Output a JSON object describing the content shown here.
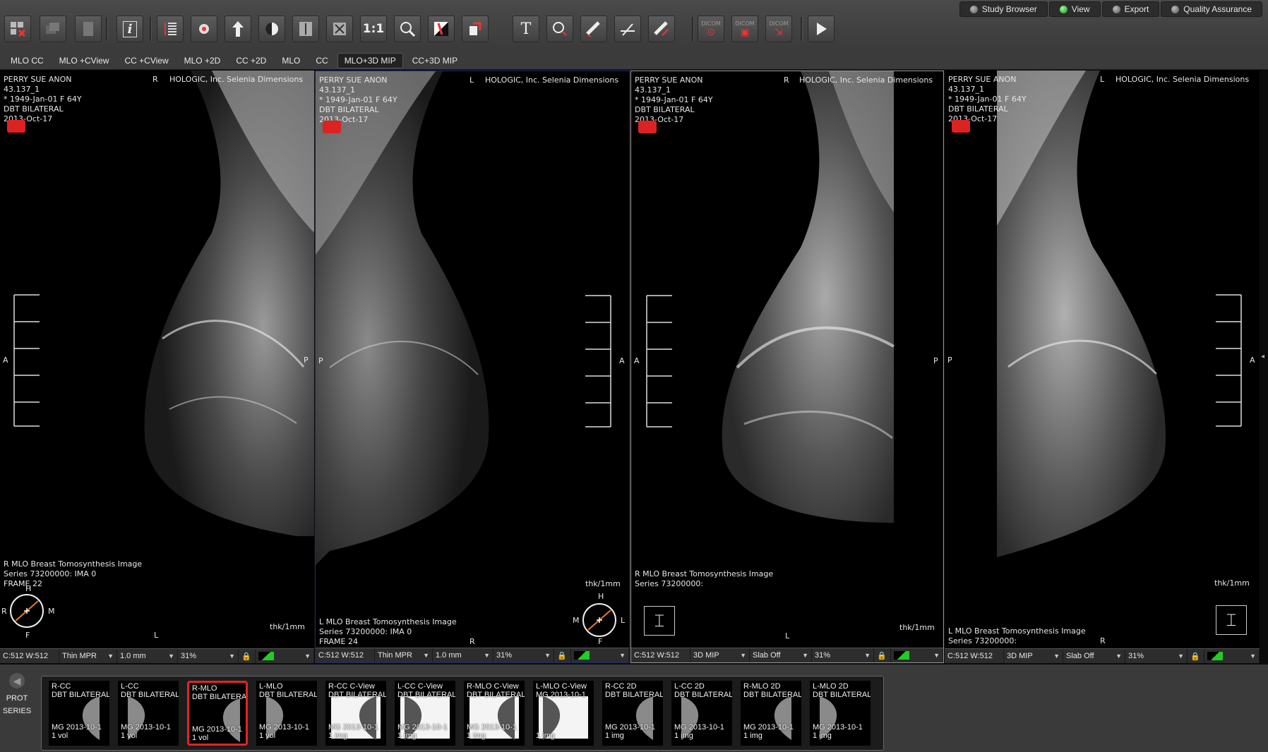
{
  "toolbar": {
    "buttons": [
      {
        "name": "close-all-icon"
      },
      {
        "name": "stack-icon"
      },
      {
        "name": "document-icon"
      },
      {
        "name": "info-icon",
        "label": "i"
      },
      {
        "name": "scroll-slices-icon"
      },
      {
        "name": "pan-hand-icon"
      },
      {
        "name": "move-arrow-icon"
      },
      {
        "name": "window-level-icon"
      },
      {
        "name": "fit-height-icon"
      },
      {
        "name": "fit-screen-icon"
      },
      {
        "name": "actual-size-icon",
        "label": "1:1"
      },
      {
        "name": "magnify-icon"
      },
      {
        "name": "invert-icon"
      },
      {
        "name": "rotate-icon"
      },
      {
        "name": "text-annotation-icon"
      },
      {
        "name": "ellipse-roi-icon"
      },
      {
        "name": "ruler-icon"
      },
      {
        "name": "angle-icon"
      },
      {
        "name": "measure-tools-icon"
      },
      {
        "name": "dicom-link-icon",
        "label": "DICOM"
      },
      {
        "name": "dicom-snapshot-icon",
        "label": "DICOM"
      },
      {
        "name": "dicom-export-icon",
        "label": "DICOM"
      },
      {
        "name": "play-cine-icon"
      }
    ]
  },
  "topnav": [
    {
      "label": "Study Browser",
      "on": false
    },
    {
      "label": "View",
      "on": true
    },
    {
      "label": "Export",
      "on": false
    },
    {
      "label": "Quality Assurance",
      "on": false
    }
  ],
  "hanging_protocols": [
    "MLO CC",
    "MLO +CView",
    "CC +CView",
    "MLO +2D",
    "CC +2D",
    "MLO",
    "CC",
    "MLO+3D MIP",
    "CC+3D MIP"
  ],
  "hp_active": "MLO+3D MIP",
  "viewports": [
    {
      "patient": "PERRY SUE ANON",
      "id": "43.137_1",
      "dob": "* 1949-Jan-01 F 64Y",
      "study": "DBT BILATERAL",
      "date": "2013-Oct-17",
      "laterality": "R",
      "vendor": "HOLOGIC, Inc. Selenia Dimensions",
      "left_marker": "A",
      "right_marker": "P",
      "bottom_marker": "L",
      "desc": "R MLO Breast Tomosynthesis Image",
      "series": "Series 73200000: IMA 0",
      "frame": "FRAME 22",
      "thk": "thk/1mm",
      "compass": {
        "top": "H",
        "bottom": "F",
        "left": "R",
        "right": "M"
      },
      "status": {
        "wl": "C:512 W:512",
        "mode": "Thin MPR",
        "slab": "1.0 mm",
        "zoom": "31%"
      }
    },
    {
      "patient": "PERRY SUE ANON",
      "id": "43.137_1",
      "dob": "* 1949-Jan-01 F 64Y",
      "study": "DBT BILATERAL",
      "date": "2013-Oct-17",
      "laterality": "L",
      "vendor": "HOLOGIC, Inc. Selenia Dimensions",
      "left_marker": "P",
      "right_marker": "A",
      "bottom_marker": "R",
      "desc": "L MLO Breast Tomosynthesis Image",
      "series": "Series 73200000: IMA 0",
      "frame": "FRAME 24",
      "thk": "thk/1mm",
      "compass": {
        "top": "H",
        "bottom": "F",
        "left": "M",
        "right": "L"
      },
      "status": {
        "wl": "C:512 W:512",
        "mode": "Thin MPR",
        "slab": "1.0 mm",
        "zoom": "31%"
      }
    },
    {
      "patient": "PERRY SUE ANON",
      "id": "43.137_1",
      "dob": "* 1949-Jan-01 F 64Y",
      "study": "DBT BILATERAL",
      "date": "2013-Oct-17",
      "laterality": "R",
      "vendor": "HOLOGIC, Inc. Selenia Dimensions",
      "left_marker": "A",
      "right_marker": "P",
      "bottom_marker": "L",
      "desc": "R MLO Breast Tomosynthesis Image",
      "series": "Series 73200000:",
      "frame": "",
      "thk": "thk/1mm",
      "status": {
        "wl": "C:512 W:512",
        "mode": "3D MIP",
        "slab": "Slab Off",
        "zoom": "31%"
      }
    },
    {
      "patient": "PERRY SUE ANON",
      "id": "43.137_1",
      "dob": "* 1949-Jan-01 F 64Y",
      "study": "DBT BILATERAL",
      "date": "2013-Oct-17",
      "laterality": "L",
      "vendor": "HOLOGIC, Inc. Selenia Dimensions",
      "left_marker": "P",
      "right_marker": "A",
      "bottom_marker": "R",
      "desc": "L MLO Breast Tomosynthesis Image",
      "series": "Series 73200000:",
      "frame": "",
      "thk": "thk/1mm",
      "status": {
        "wl": "C:512 W:512",
        "mode": "3D MIP",
        "slab": "Slab Off",
        "zoom": "31%"
      }
    }
  ],
  "side": {
    "prot": "PROT",
    "series": "SERIES"
  },
  "thumbnails": [
    {
      "title": "R-CC",
      "sub": "DBT BILATERAL",
      "mg": "MG 2013-10-1",
      "count": "1 vol"
    },
    {
      "title": "L-CC",
      "sub": "DBT BILATERAL",
      "mg": "MG 2013-10-1",
      "count": "1 vol"
    },
    {
      "title": "R-MLO",
      "sub": "DBT BILATERAL",
      "mg": "MG 2013-10-1",
      "count": "1 vol",
      "active": true
    },
    {
      "title": "L-MLO",
      "sub": "DBT BILATERAL",
      "mg": "MG 2013-10-1",
      "count": "1 vol"
    },
    {
      "title": "R-CC C-View",
      "sub": "DBT BILATERAL",
      "mg": "MG 2013-10-1",
      "count": "1 img"
    },
    {
      "title": "L-CC C-View",
      "sub": "DBT BILATERAL",
      "mg": "MG 2013-10-1",
      "count": "1 img"
    },
    {
      "title": "R-MLO C-View",
      "sub": "DBT BILATERAL",
      "mg": "MG 2013-10-1",
      "count": "1 img"
    },
    {
      "title": "L-MLO C-View",
      "sub": "MG 2013-10-1",
      "mg": "",
      "count": "1 img"
    },
    {
      "title": "R-CC 2D",
      "sub": "DBT BILATERAL",
      "mg": "MG 2013-10-1",
      "count": "1 img"
    },
    {
      "title": "L-CC 2D",
      "sub": "DBT BILATERAL",
      "mg": "MG 2013-10-1",
      "count": "1 img"
    },
    {
      "title": "R-MLO 2D",
      "sub": "DBT BILATERAL",
      "mg": "MG 2013-10-1",
      "count": "1 img"
    },
    {
      "title": "L-MLO 2D",
      "sub": "DBT BILATERAL",
      "mg": "MG 2013-10-1",
      "count": "1 img"
    }
  ]
}
